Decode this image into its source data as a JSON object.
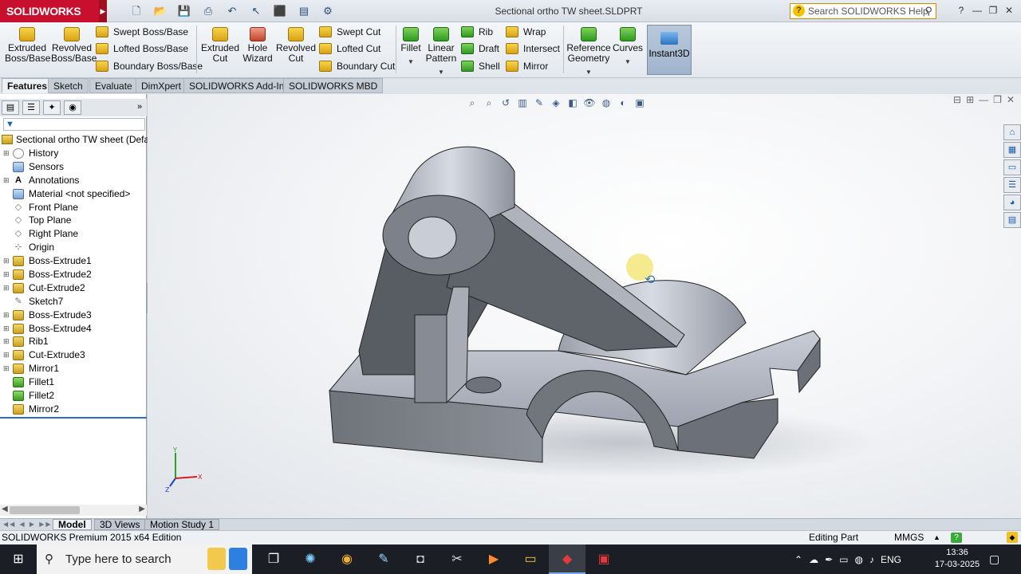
{
  "app": {
    "logo_text": "SOLIDWORKS",
    "document_title": "Sectional ortho TW sheet.SLDPRT",
    "search_placeholder": "Search SOLIDWORKS Help"
  },
  "toolbar": {
    "extruded_boss": "Extruded Boss/Base",
    "revolved_boss": "Revolved Boss/Base",
    "swept_boss": "Swept Boss/Base",
    "lofted_boss": "Lofted Boss/Base",
    "boundary_boss": "Boundary Boss/Base",
    "extruded_cut": "Extruded Cut",
    "hole_wizard": "Hole Wizard",
    "revolved_cut": "Revolved Cut",
    "swept_cut": "Swept Cut",
    "lofted_cut": "Lofted Cut",
    "boundary_cut": "Boundary Cut",
    "fillet": "Fillet",
    "linear_pattern": "Linear Pattern",
    "rib": "Rib",
    "draft": "Draft",
    "shell": "Shell",
    "wrap": "Wrap",
    "intersect": "Intersect",
    "mirror": "Mirror",
    "reference_geometry": "Reference Geometry",
    "curves": "Curves",
    "instant3d": "Instant3D"
  },
  "tabs": [
    "Features",
    "Sketch",
    "Evaluate",
    "DimXpert",
    "SOLIDWORKS Add-Ins",
    "SOLIDWORKS MBD"
  ],
  "feature_tree": {
    "root": "Sectional ortho TW sheet  (Defau",
    "items": [
      {
        "label": "History",
        "icon": "history-icon",
        "expandable": true
      },
      {
        "label": "Sensors",
        "icon": "sensors-icon",
        "expandable": false
      },
      {
        "label": "Annotations",
        "icon": "annotations-icon",
        "expandable": true
      },
      {
        "label": "Material <not specified>",
        "icon": "material-icon",
        "expandable": false
      },
      {
        "label": "Front Plane",
        "icon": "plane-icon",
        "expandable": false
      },
      {
        "label": "Top Plane",
        "icon": "plane-icon",
        "expandable": false
      },
      {
        "label": "Right Plane",
        "icon": "plane-icon",
        "expandable": false
      },
      {
        "label": "Origin",
        "icon": "origin-icon",
        "expandable": false
      },
      {
        "label": "Boss-Extrude1",
        "icon": "extrude-icon",
        "expandable": true
      },
      {
        "label": "Boss-Extrude2",
        "icon": "extrude-icon",
        "expandable": true
      },
      {
        "label": "Cut-Extrude2",
        "icon": "cut-extrude-icon",
        "expandable": true
      },
      {
        "label": "Sketch7",
        "icon": "sketch-icon",
        "expandable": false
      },
      {
        "label": "Boss-Extrude3",
        "icon": "extrude-icon",
        "expandable": true
      },
      {
        "label": "Boss-Extrude4",
        "icon": "extrude-icon",
        "expandable": true
      },
      {
        "label": "Rib1",
        "icon": "rib-icon",
        "expandable": true
      },
      {
        "label": "Cut-Extrude3",
        "icon": "cut-extrude-icon",
        "expandable": true
      },
      {
        "label": "Mirror1",
        "icon": "mirror-icon",
        "expandable": true
      },
      {
        "label": "Fillet1",
        "icon": "fillet-icon",
        "expandable": false
      },
      {
        "label": "Fillet2",
        "icon": "fillet-icon",
        "expandable": false
      },
      {
        "label": "Mirror2",
        "icon": "mirror-icon",
        "expandable": false
      }
    ]
  },
  "bottom_tabs": [
    "Model",
    "3D Views",
    "Motion Study 1"
  ],
  "status": {
    "left": "SOLIDWORKS Premium 2015 x64 Edition",
    "mode": "Editing Part",
    "units": "MMGS"
  },
  "taskbar": {
    "search_placeholder": "Type here to search",
    "language": "ENG",
    "time": "13:36",
    "date": "17-03-2025"
  },
  "colors": {
    "brand": "#c8102e",
    "model_face": "#8a8e96",
    "viewport_bg": "#f4f5f7"
  }
}
